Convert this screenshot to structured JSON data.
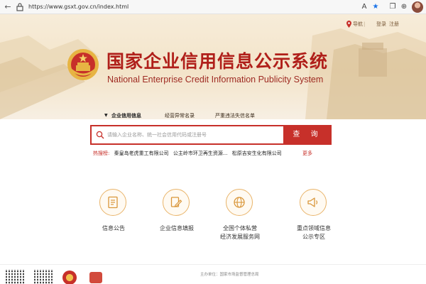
{
  "browser": {
    "url": "https://www.gsxt.gov.cn/index.html",
    "back_icon": "back-arrow-icon",
    "refresh_icon": "refresh-icon"
  },
  "header": {
    "nav_label": "导航",
    "login_label": "登录",
    "register_label": "注册"
  },
  "site": {
    "title_cn": "国家企业信用信息公示系统",
    "title_en": "National Enterprise Credit Information Publicity System"
  },
  "search": {
    "tabs": [
      "企业信用信息",
      "经营异常名录",
      "严重违法失信名单"
    ],
    "active_tab": 0,
    "placeholder": "请输入企业名称、统一社会信用代码或注册号",
    "button_label": "查 询"
  },
  "hot_search": {
    "label": "热搜榜:",
    "items": [
      "秦皇岛老虎重工有限公司",
      "公主岭市环卫再生资源...",
      "松原吉安生化有限公司"
    ],
    "more_label": "更多"
  },
  "features": [
    {
      "label_line1": "信息公告",
      "label_line2": "",
      "icon": "document-icon"
    },
    {
      "label_line1": "企业信息填报",
      "label_line2": "",
      "icon": "edit-pen-icon"
    },
    {
      "label_line1": "全国个体私营",
      "label_line2": "经济发展服务网",
      "icon": "network-globe-icon"
    },
    {
      "label_line1": "重点领域信息",
      "label_line2": "公示专区",
      "icon": "megaphone-icon"
    }
  ],
  "footer": {
    "sponsor": "主办单位：国家市场监督管理总局"
  },
  "colors": {
    "brand_red": "#c7302a",
    "banner_bg": "#f3e4c9",
    "icon_ring": "#e9b46a"
  }
}
